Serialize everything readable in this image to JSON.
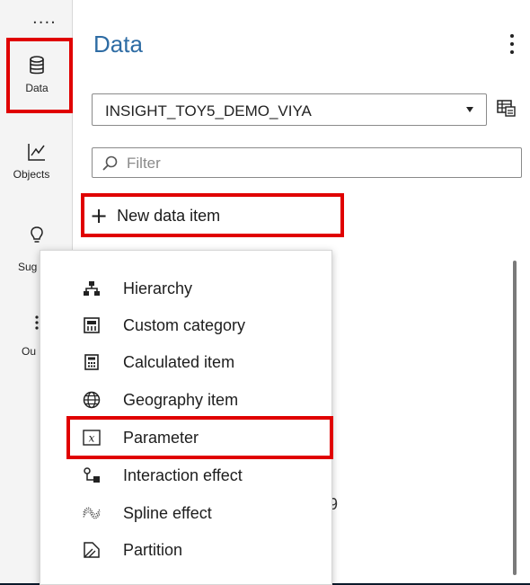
{
  "rail": {
    "more_label": "....",
    "items": [
      {
        "label": "Data",
        "icon": "database-icon"
      },
      {
        "label": "Objects",
        "icon": "line-chart-icon"
      },
      {
        "label": "Sug",
        "icon": "lightbulb-icon"
      },
      {
        "label": "Ou",
        "icon": "outline-icon"
      }
    ]
  },
  "panel": {
    "title": "Data",
    "data_source": "INSIGHT_TOY5_DEMO_VIYA",
    "filter_placeholder": "Filter",
    "new_data_item_label": "New data item",
    "background_fragment": "9"
  },
  "menu": {
    "items": [
      {
        "label": "Hierarchy",
        "icon": "hierarchy-icon"
      },
      {
        "label": "Custom category",
        "icon": "custom-category-icon"
      },
      {
        "label": "Calculated item",
        "icon": "calculator-icon"
      },
      {
        "label": "Geography item",
        "icon": "globe-icon"
      },
      {
        "label": "Parameter",
        "icon": "parameter-x-icon"
      },
      {
        "label": "Interaction effect",
        "icon": "interaction-effect-icon"
      },
      {
        "label": "Spline effect",
        "icon": "spline-effect-icon"
      },
      {
        "label": "Partition",
        "icon": "partition-icon"
      }
    ]
  },
  "colors": {
    "title_blue": "#2e6ca4",
    "highlight_red": "#e00000"
  }
}
